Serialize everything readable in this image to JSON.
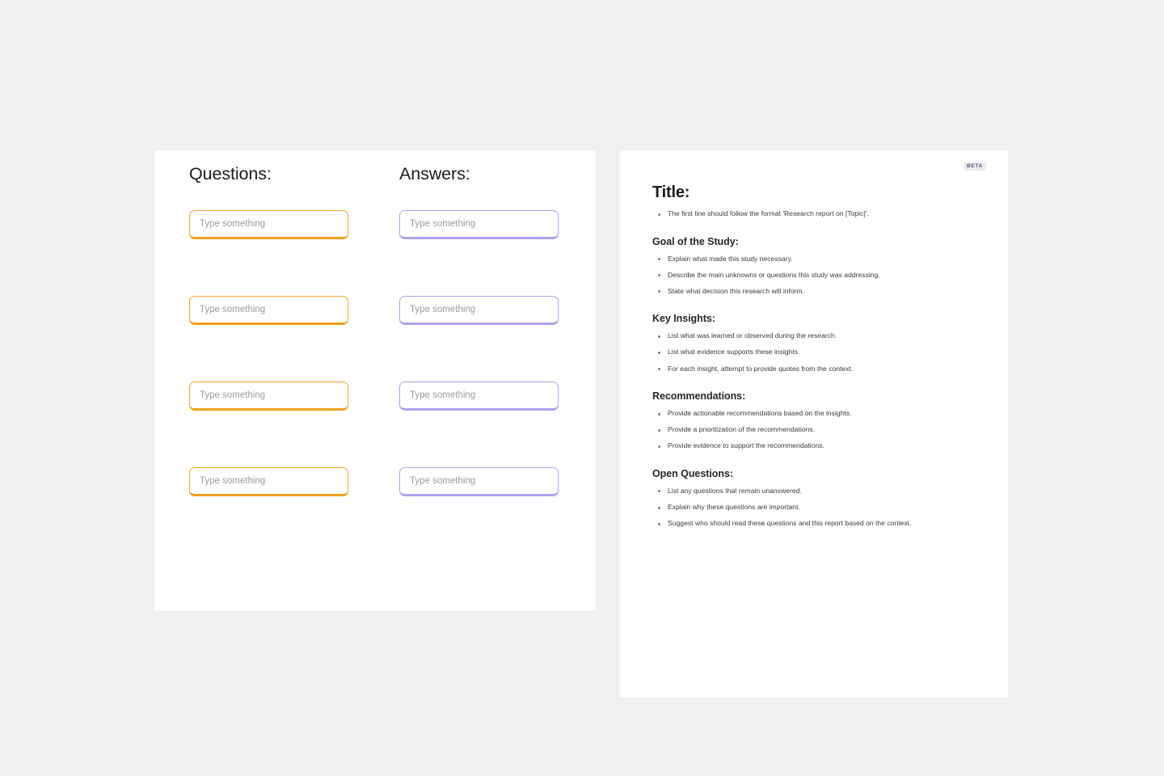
{
  "background_color": "#f0f0f0",
  "qa_panel": {
    "columns": [
      {
        "name": "questions",
        "title": "Questions:",
        "accent_color": "#f5a623",
        "fields": [
          {
            "value": "",
            "placeholder": "Type something"
          },
          {
            "value": "",
            "placeholder": "Type something"
          },
          {
            "value": "",
            "placeholder": "Type something"
          },
          {
            "value": "",
            "placeholder": "Type something"
          }
        ]
      },
      {
        "name": "answers",
        "title": "Answers:",
        "accent_color": "#a7a3ef",
        "fields": [
          {
            "value": "",
            "placeholder": "Type something"
          },
          {
            "value": "",
            "placeholder": "Type something"
          },
          {
            "value": "",
            "placeholder": "Type something"
          },
          {
            "value": "",
            "placeholder": "Type something"
          }
        ]
      }
    ]
  },
  "doc_panel": {
    "badge": "BETA",
    "badge_color": "#585872",
    "title": "Title:",
    "sections": [
      {
        "heading": "Title:",
        "is_title": true,
        "items": [
          "The first line should follow the format 'Research report on [Topic]'."
        ]
      },
      {
        "heading": "Goal of the Study:",
        "is_title": false,
        "items": [
          "Explain what made this study necessary.",
          "Describe the main unknowns or questions this study was addressing.",
          "State what decision this research will inform."
        ]
      },
      {
        "heading": "Key Insights:",
        "is_title": false,
        "items": [
          "List what was learned or observed during the research.",
          "List what evidence supports these insights.",
          "For each insight, attempt to provide quotes from the context."
        ]
      },
      {
        "heading": "Recommendations:",
        "is_title": false,
        "items": [
          "Provide actionable recommendations based on the insights.",
          "Provide a prioritization of the recommendations.",
          "Provide evidence to support the recommendations."
        ]
      },
      {
        "heading": "Open Questions:",
        "is_title": false,
        "items": [
          "List any questions that remain unanswered.",
          "Explain why these questions are important.",
          "Suggest who should read these questions and this report based on the context."
        ]
      }
    ]
  }
}
